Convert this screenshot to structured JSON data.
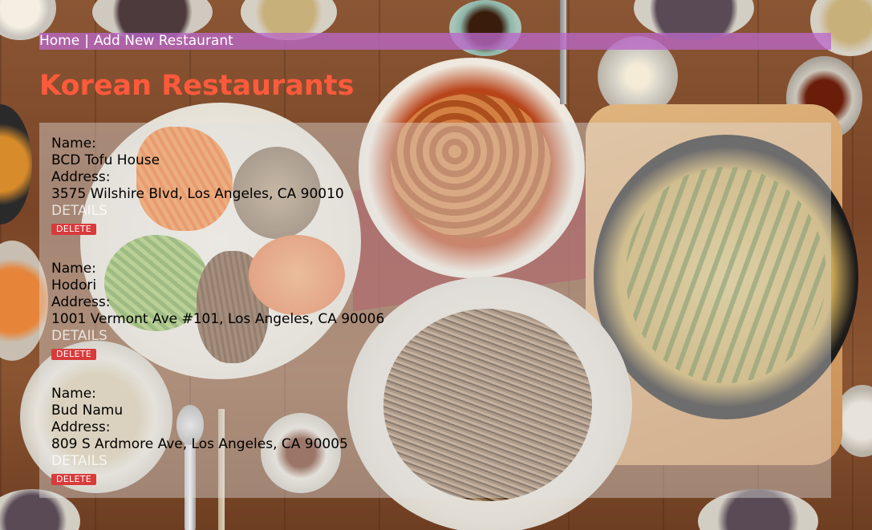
{
  "nav": {
    "home_label": "Home",
    "separator": "|",
    "add_label": "Add New Restaurant"
  },
  "page": {
    "title": "Korean Restaurants"
  },
  "restaurants": [
    {
      "name_label": "Name:",
      "name": "BCD Tofu House",
      "address_label": "Address:",
      "address": "3575 Wilshire Blvd, Los Angeles, CA 90010",
      "details_label": "DETAILS",
      "delete_label": "DELETE"
    },
    {
      "name_label": "Name:",
      "name": "Hodori",
      "address_label": "Address:",
      "address": "1001 Vermont Ave #101, Los Angeles, CA 90006",
      "details_label": "DETAILS",
      "delete_label": "DELETE"
    },
    {
      "name_label": "Name:",
      "name": "Bud Namu",
      "address_label": "Address:",
      "address": "809 S Ardmore Ave, Los Angeles, CA 90005",
      "details_label": "DETAILS",
      "delete_label": "DELETE"
    }
  ],
  "colors": {
    "title": "#ff5a3c",
    "navbar": "#ba68c8",
    "delete_button": "#d93a3a"
  }
}
